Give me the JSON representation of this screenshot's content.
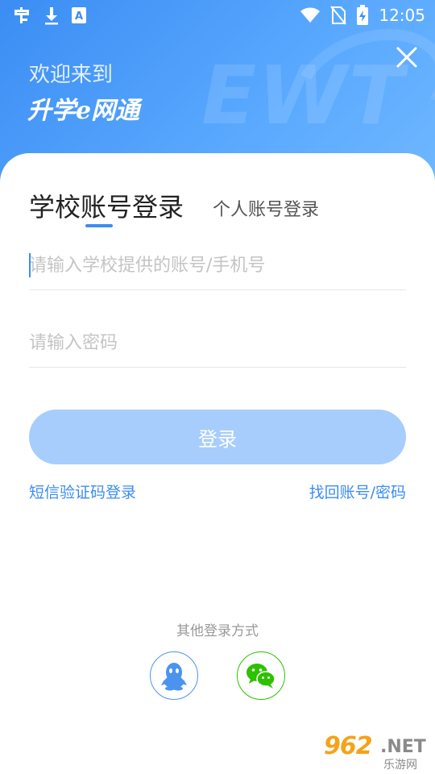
{
  "status_bar": {
    "time": "12:05",
    "left_icons": [
      "app-notification-icon",
      "download-icon",
      "text-a-icon"
    ],
    "right_icons": [
      "wifi-icon",
      "no-sim-icon",
      "battery-charging-icon"
    ]
  },
  "header": {
    "welcome": "欢迎来到",
    "app_name": "升学e网通",
    "watermark": "EWT",
    "close_icon": "close-icon"
  },
  "tabs": {
    "active": "学校账号登录",
    "inactive": "个人账号登录"
  },
  "form": {
    "account_placeholder": "请输入学校提供的账号/手机号",
    "password_placeholder": "请输入密码",
    "login_label": "登录"
  },
  "links": {
    "sms_login": "短信验证码登录",
    "recover": "找回账号/密码"
  },
  "other_login": {
    "label": "其他登录方式",
    "options": [
      "qq-icon",
      "wechat-icon"
    ]
  },
  "badge": {
    "number": "962",
    "tld": ".NET",
    "sub": "乐游网"
  },
  "colors": {
    "primary": "#3b8df3",
    "button_disabled": "#a7cdfc",
    "qq": "#4a94f0",
    "wechat": "#2dc100"
  }
}
